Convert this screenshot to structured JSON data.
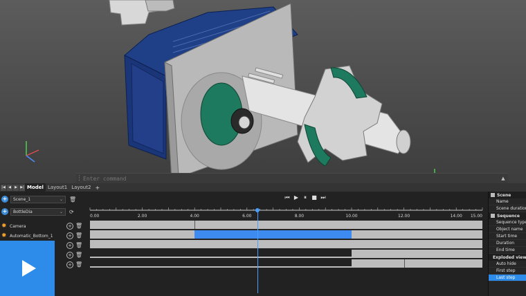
{
  "command": {
    "placeholder": "Enter command"
  },
  "layout_tabs": {
    "nav": [
      "|◀",
      "◀",
      "▶",
      "▶|"
    ],
    "tabs": [
      {
        "label": "Model",
        "active": true
      },
      {
        "label": "Layout1",
        "active": false
      },
      {
        "label": "Layout2",
        "active": false
      }
    ],
    "add": "+"
  },
  "scene_panel": {
    "scene_select": "Scene_1",
    "sequence_select": "BottleDia",
    "objects": [
      {
        "label": "Camera"
      },
      {
        "label": "Automatic_Bottom_1"
      }
    ]
  },
  "timeline": {
    "ticks": [
      "0.00",
      "2.00",
      "4.00",
      "6.00",
      "8.00",
      "10.00",
      "12.00",
      "14.00",
      "15.00"
    ],
    "range": [
      0,
      15
    ],
    "cursor": 6.4,
    "tracks": [
      {
        "type": "bar",
        "segments": [
          {
            "start": 0,
            "end": 15,
            "color": "#bdbdbd"
          }
        ],
        "marks": [
          4
        ]
      },
      {
        "type": "bar",
        "segments": [
          {
            "start": 0,
            "end": 4,
            "color": "#bdbdbd"
          },
          {
            "start": 4,
            "end": 10,
            "color": "#3d8bf0"
          },
          {
            "start": 10,
            "end": 15,
            "color": "#bdbdbd"
          }
        ],
        "marks": []
      },
      {
        "type": "bar",
        "segments": [
          {
            "start": 0,
            "end": 15,
            "color": "#bdbdbd"
          }
        ],
        "marks": []
      },
      {
        "type": "line",
        "segments": [
          {
            "start": 10,
            "end": 15,
            "color": "#bdbdbd"
          }
        ],
        "marks": []
      },
      {
        "type": "line",
        "segments": [
          {
            "start": 10,
            "end": 15,
            "color": "#bdbdbd"
          }
        ],
        "marks": [
          12
        ]
      }
    ]
  },
  "properties": {
    "sections": [
      {
        "title": "Scene",
        "items": [
          "Name",
          "Scene duration"
        ]
      },
      {
        "title": "Sequence",
        "items": [
          "Sequence type",
          "Object name",
          "Start time",
          "Duration",
          "End time"
        ]
      },
      {
        "title": "Exploded view",
        "items": [
          "Auto hide",
          "First step",
          "Last step"
        ]
      }
    ],
    "selected": "Last step"
  },
  "colors": {
    "accent": "#2d8cea",
    "motor_blue": "#1f3f86",
    "part_green": "#1e7a5e"
  }
}
